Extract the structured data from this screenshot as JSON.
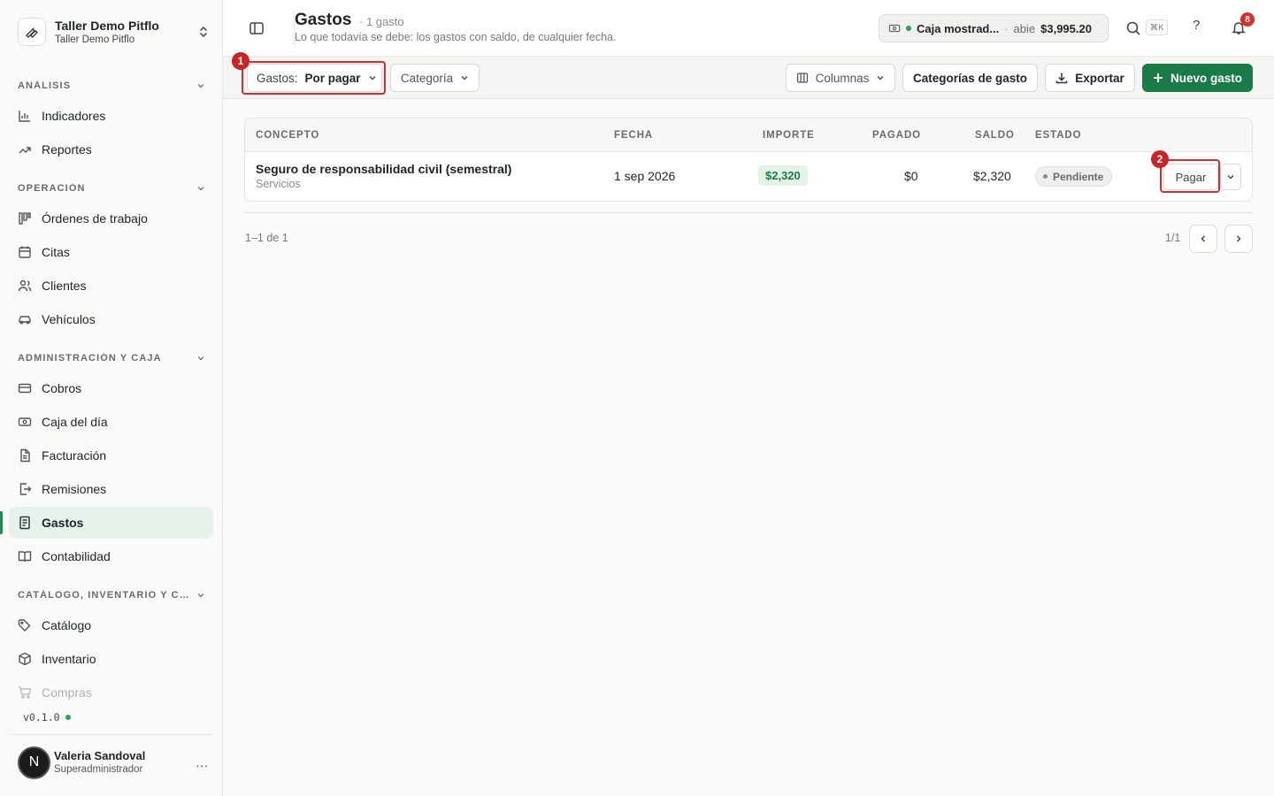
{
  "org": {
    "name": "Taller Demo Pitflo",
    "subtitle": "Taller Demo Pitflo"
  },
  "sidebar": {
    "sections": [
      {
        "label": "Análisis",
        "items": [
          {
            "label": "Indicadores",
            "icon": "bar-chart-icon"
          },
          {
            "label": "Reportes",
            "icon": "trending-icon"
          }
        ]
      },
      {
        "label": "Operación",
        "items": [
          {
            "label": "Órdenes de trabajo",
            "icon": "kanban-icon"
          },
          {
            "label": "Citas",
            "icon": "calendar-icon"
          },
          {
            "label": "Clientes",
            "icon": "users-icon"
          },
          {
            "label": "Vehículos",
            "icon": "car-icon"
          }
        ]
      },
      {
        "label": "Administración y caja",
        "items": [
          {
            "label": "Cobros",
            "icon": "credit-card-icon"
          },
          {
            "label": "Caja del día",
            "icon": "cash-icon"
          },
          {
            "label": "Facturación",
            "icon": "file-icon"
          },
          {
            "label": "Remisiones",
            "icon": "file-export-icon"
          },
          {
            "label": "Gastos",
            "icon": "receipt-icon",
            "active": true
          },
          {
            "label": "Contabilidad",
            "icon": "book-icon"
          }
        ]
      },
      {
        "label": "Catálogo, inventario y co...",
        "items": [
          {
            "label": "Catálogo",
            "icon": "tags-icon"
          },
          {
            "label": "Inventario",
            "icon": "box-icon"
          },
          {
            "label": "Compras",
            "icon": "cart-icon"
          }
        ]
      }
    ],
    "version": "v0.1.0"
  },
  "user": {
    "initial": "N",
    "name": "Valeria Sandoval",
    "role": "Superadministrador",
    "menu": "..."
  },
  "header": {
    "title": "Gastos",
    "count": "· 1 gasto",
    "subtitle": "Lo que todavía se debe: los gastos con saldo, de cualquier fecha.",
    "cash": {
      "name": "Caja mostrad...",
      "separator": "·",
      "state": "abie",
      "amount": "$3,995.20"
    },
    "search_shortcut": "⌘K",
    "help": "?",
    "notifications": "8"
  },
  "toolbar": {
    "filter_key": "Gastos:",
    "filter_value": "Por pagar",
    "category": "Categoría",
    "columns": "Columnas",
    "expense_categories": "Categorías de gasto",
    "export": "Exportar",
    "new_expense": "Nuevo gasto"
  },
  "annotations": {
    "one": "1",
    "two": "2"
  },
  "table": {
    "headers": {
      "concept": "Concepto",
      "date": "Fecha",
      "amount": "Importe",
      "paid": "Pagado",
      "balance": "Saldo",
      "status": "Estado"
    },
    "rows": [
      {
        "concept": "Seguro de responsabilidad civil (semestral)",
        "category": "Servicios",
        "date": "1 sep 2026",
        "amount": "$2,320",
        "paid": "$0",
        "balance": "$2,320",
        "status": "Pendiente",
        "action": "Pagar"
      }
    ]
  },
  "pagination": {
    "range": "1–1 de 1",
    "page": "1/1"
  },
  "colors": {
    "brand": "#1a7a48",
    "active_bg": "#e6f2ea",
    "annotation": "#d62d2d"
  }
}
